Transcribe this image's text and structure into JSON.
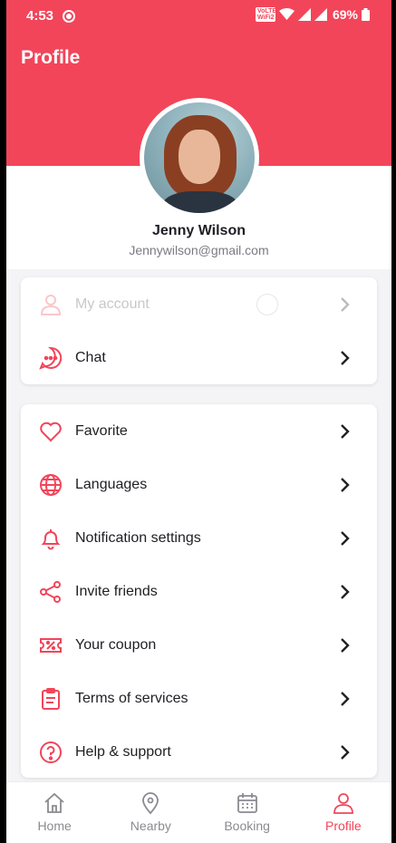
{
  "status_bar": {
    "time": "4:53",
    "wifi_tag_line1": "VoLTE",
    "wifi_tag_line2": "WiFi2",
    "battery": "69%"
  },
  "header": {
    "title": "Profile",
    "accent_color": "#f2455a"
  },
  "user": {
    "name": "Jenny Wilson",
    "email": "Jennywilson@gmail.com"
  },
  "menu_group_1": [
    {
      "label": "My account",
      "icon": "user-icon"
    },
    {
      "label": "Chat",
      "icon": "chat-bubble-icon"
    }
  ],
  "menu_group_2": [
    {
      "label": "Favorite",
      "icon": "heart-icon"
    },
    {
      "label": "Languages",
      "icon": "globe-icon"
    },
    {
      "label": "Notification settings",
      "icon": "bell-icon"
    },
    {
      "label": "Invite friends",
      "icon": "share-icon"
    },
    {
      "label": "Your coupon",
      "icon": "coupon-icon"
    },
    {
      "label": "Terms of services",
      "icon": "clipboard-icon"
    },
    {
      "label": "Help & support",
      "icon": "question-icon"
    }
  ],
  "tabbar": [
    {
      "label": "Home",
      "icon": "home-icon"
    },
    {
      "label": "Nearby",
      "icon": "location-pin-icon"
    },
    {
      "label": "Booking",
      "icon": "calendar-icon"
    },
    {
      "label": "Profile",
      "icon": "user-icon",
      "active": true
    }
  ]
}
